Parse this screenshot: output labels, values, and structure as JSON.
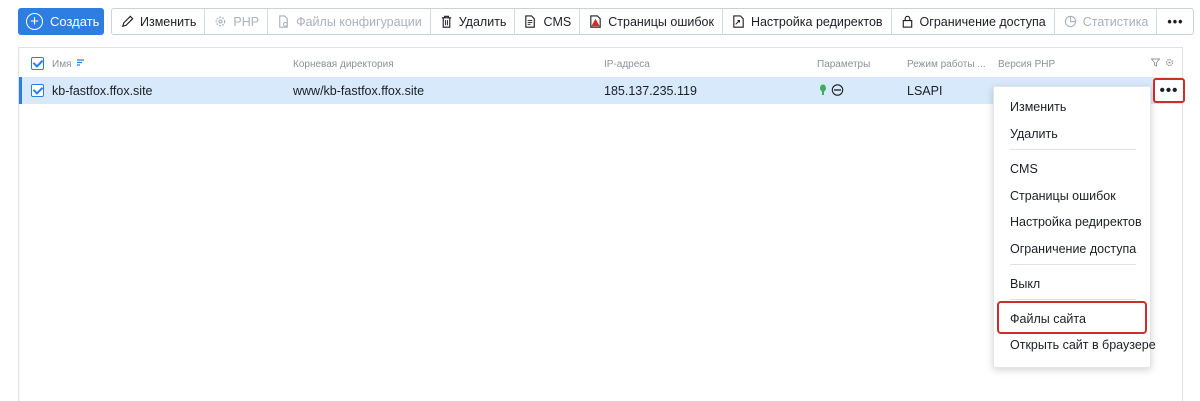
{
  "toolbar": {
    "create": "Создать",
    "edit": "Изменить",
    "php": "PHP",
    "config_files": "Файлы конфигурации",
    "delete": "Удалить",
    "cms": "CMS",
    "error_pages": "Страницы ошибок",
    "redirects": "Настройка редиректов",
    "access_limit": "Ограничение доступа",
    "stats": "Статистика",
    "more": "•••"
  },
  "table": {
    "columns": {
      "name": "Имя",
      "root_dir": "Корневая директория",
      "ip": "IP-адреса",
      "params": "Параметры",
      "mode": "Режим работы ...",
      "php_version": "Версия PHP"
    },
    "rows": [
      {
        "name": "kb-fastfox.ffox.site",
        "root_dir": "www/kb-fastfox.ffox.site",
        "ip": "185.137.235.119",
        "mode": "LSAPI"
      }
    ]
  },
  "row_menu": {
    "button": "•••",
    "items": {
      "edit": "Изменить",
      "delete": "Удалить",
      "cms": "CMS",
      "error_pages": "Страницы ошибок",
      "redirects": "Настройка редиректов",
      "access_limit": "Ограничение доступа",
      "off": "Выкл",
      "site_files": "Файлы сайта",
      "open_browser": "Открыть сайт в браузере"
    }
  },
  "colors": {
    "accent": "#2d7ee0",
    "row_selected": "#d8e9fb",
    "highlight": "#d22b2b"
  }
}
